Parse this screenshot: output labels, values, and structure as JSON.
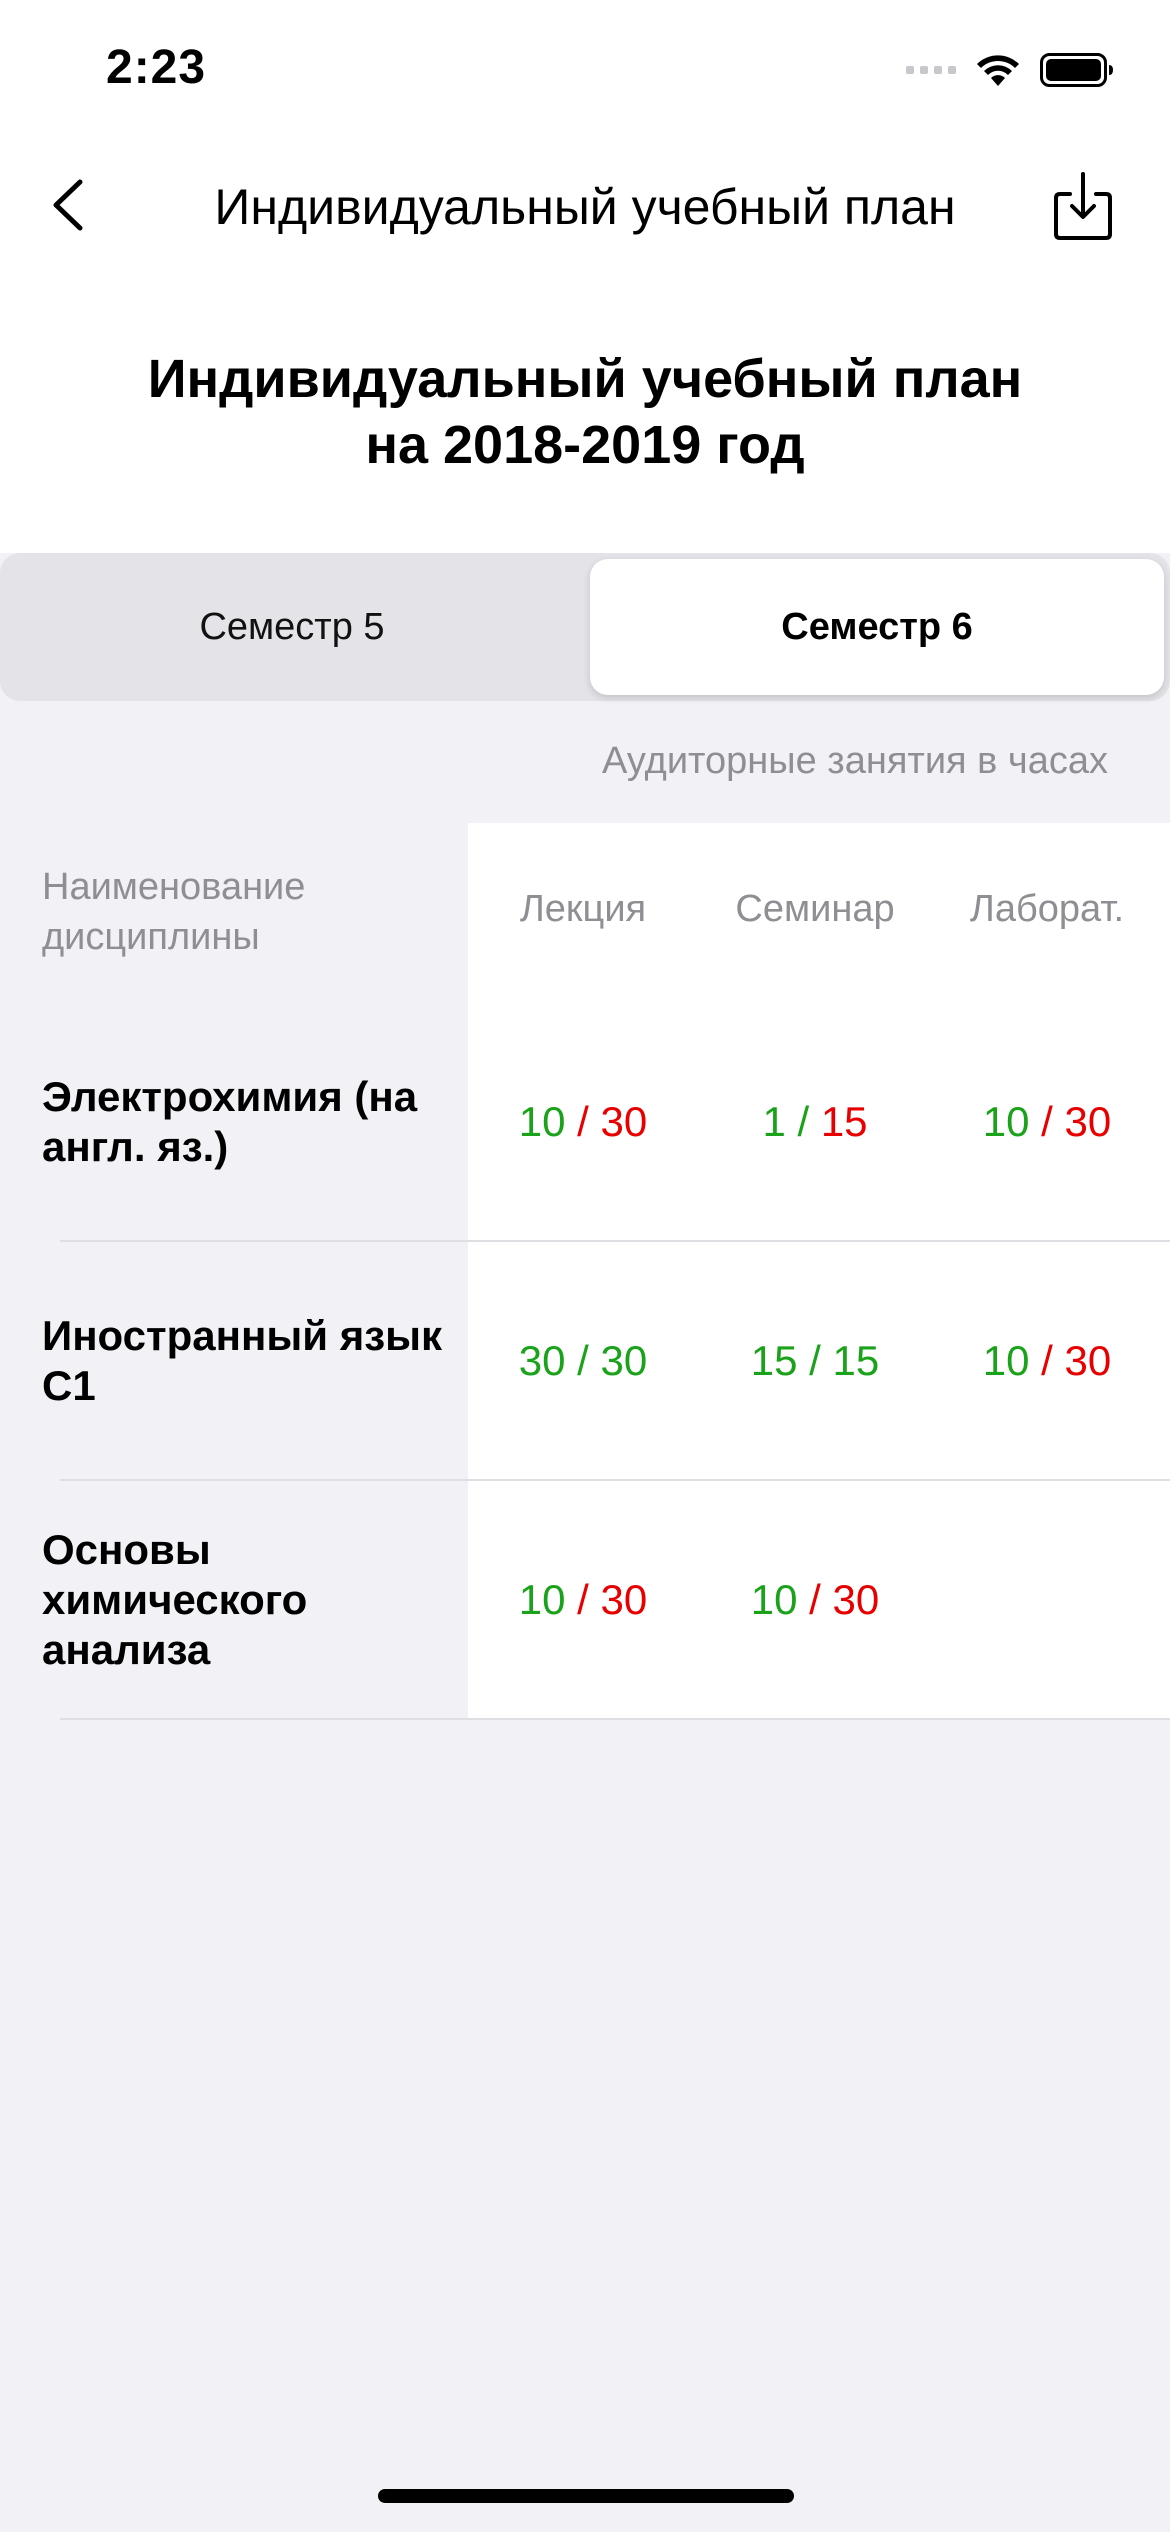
{
  "status_bar": {
    "time": "2:23"
  },
  "nav": {
    "title": "Индивидуальный учебный план"
  },
  "heading": {
    "line1": "Индивидуальный учебный план",
    "line2": "на 2018-2019 год"
  },
  "tabs": [
    {
      "label": "Семестр 5",
      "selected": false
    },
    {
      "label": "Семестр 6",
      "selected": true
    }
  ],
  "table": {
    "caption": "Аудиторные занятия в часах",
    "name_header": "Наименование дисциплины",
    "columns": [
      "Лекция",
      "Семинар",
      "Лаборат."
    ],
    "rows": [
      {
        "name": "Электрохимия (на англ. яз.)",
        "cells": [
          {
            "done": "10",
            "total": "30"
          },
          {
            "done": "1",
            "total": "15"
          },
          {
            "done": "10",
            "total": "30"
          }
        ]
      },
      {
        "name": "Иностранный язык С1",
        "cells": [
          {
            "done": "30",
            "total": "30"
          },
          {
            "done": "15",
            "total": "15"
          },
          {
            "done": "10",
            "total": "30"
          }
        ]
      },
      {
        "name": "Основы химического анализа",
        "cells": [
          {
            "done": "10",
            "total": "30"
          },
          {
            "done": "10",
            "total": "30"
          }
        ]
      }
    ]
  },
  "colors": {
    "complete": "#1aa31a",
    "incomplete": "#e80000",
    "muted": "#8e8e93"
  }
}
